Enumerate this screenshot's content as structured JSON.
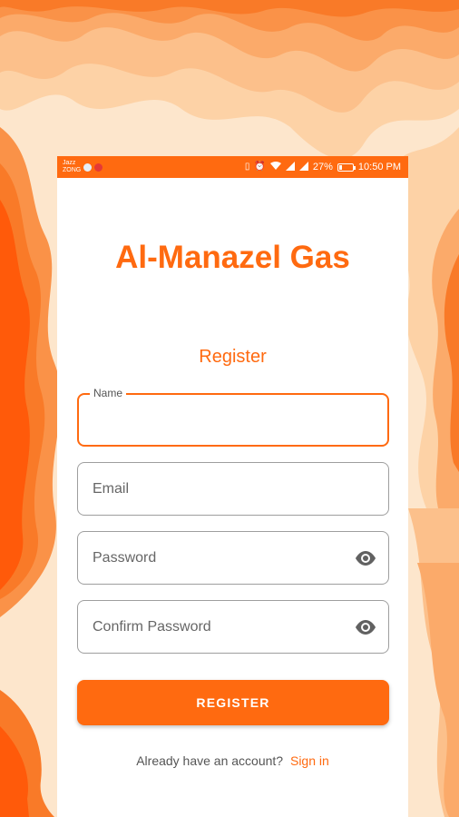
{
  "app": {
    "title": "Al-Manazel Gas"
  },
  "status_bar": {
    "carrier_line1": "Jazz",
    "carrier_line2": "ZONG",
    "battery_text": "27%",
    "battery_level": 0.27,
    "time": "10:50 PM"
  },
  "form": {
    "heading": "Register",
    "name": {
      "label": "Name",
      "value": ""
    },
    "email": {
      "placeholder": "Email"
    },
    "password": {
      "placeholder": "Password",
      "toggle_icon": "eye-icon"
    },
    "confirm_password": {
      "placeholder": "Confirm Password",
      "toggle_icon": "eye-icon"
    },
    "submit_label": "REGISTER"
  },
  "footer": {
    "prompt": "Already have an account?",
    "link_label": "Sign in"
  },
  "colors": {
    "accent": "#ff6a10",
    "background_light": "#fde1c2",
    "background_mid": "#fbab6b",
    "background_dark": "#ff5a0a"
  }
}
